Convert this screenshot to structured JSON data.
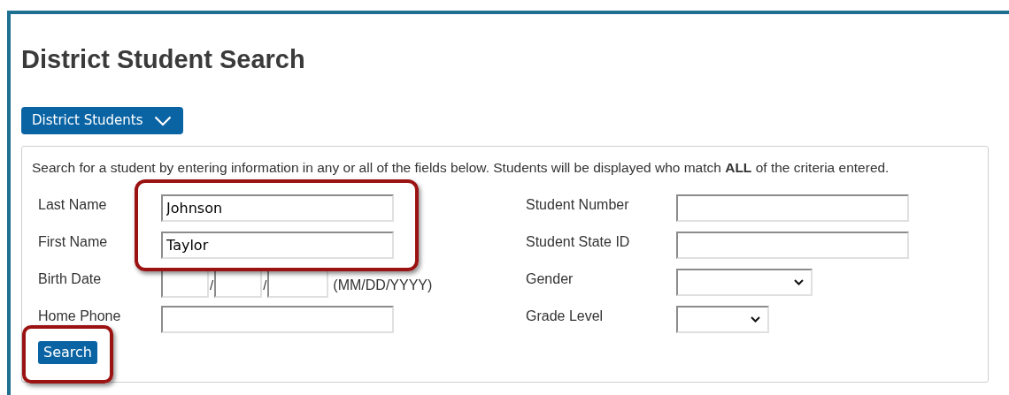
{
  "page": {
    "title": "District Student Search"
  },
  "scope_menu": {
    "label": "District Students"
  },
  "search_panel": {
    "instructions": "Search for a student by entering information in any or all of the fields below. Students will be displayed who match **ALL** of the criteria entered.",
    "left_fields": [
      {
        "kind": "text",
        "label": "Last Name",
        "value": "Johnson"
      },
      {
        "kind": "text",
        "label": "First Name",
        "value": "Taylor"
      },
      {
        "kind": "date",
        "label": "Birth Date",
        "separators": [
          "/",
          "/"
        ],
        "format_hint": "(MM/DD/YYYY)"
      },
      {
        "kind": "text",
        "label": "Home Phone"
      }
    ],
    "right_fields": [
      {
        "kind": "text",
        "label": "Student Number"
      },
      {
        "kind": "text",
        "label": "Student State ID"
      },
      {
        "kind": "select",
        "label": "Gender"
      },
      {
        "kind": "select",
        "label": "Grade Level"
      }
    ],
    "search_button": {
      "label": "Search"
    }
  }
}
